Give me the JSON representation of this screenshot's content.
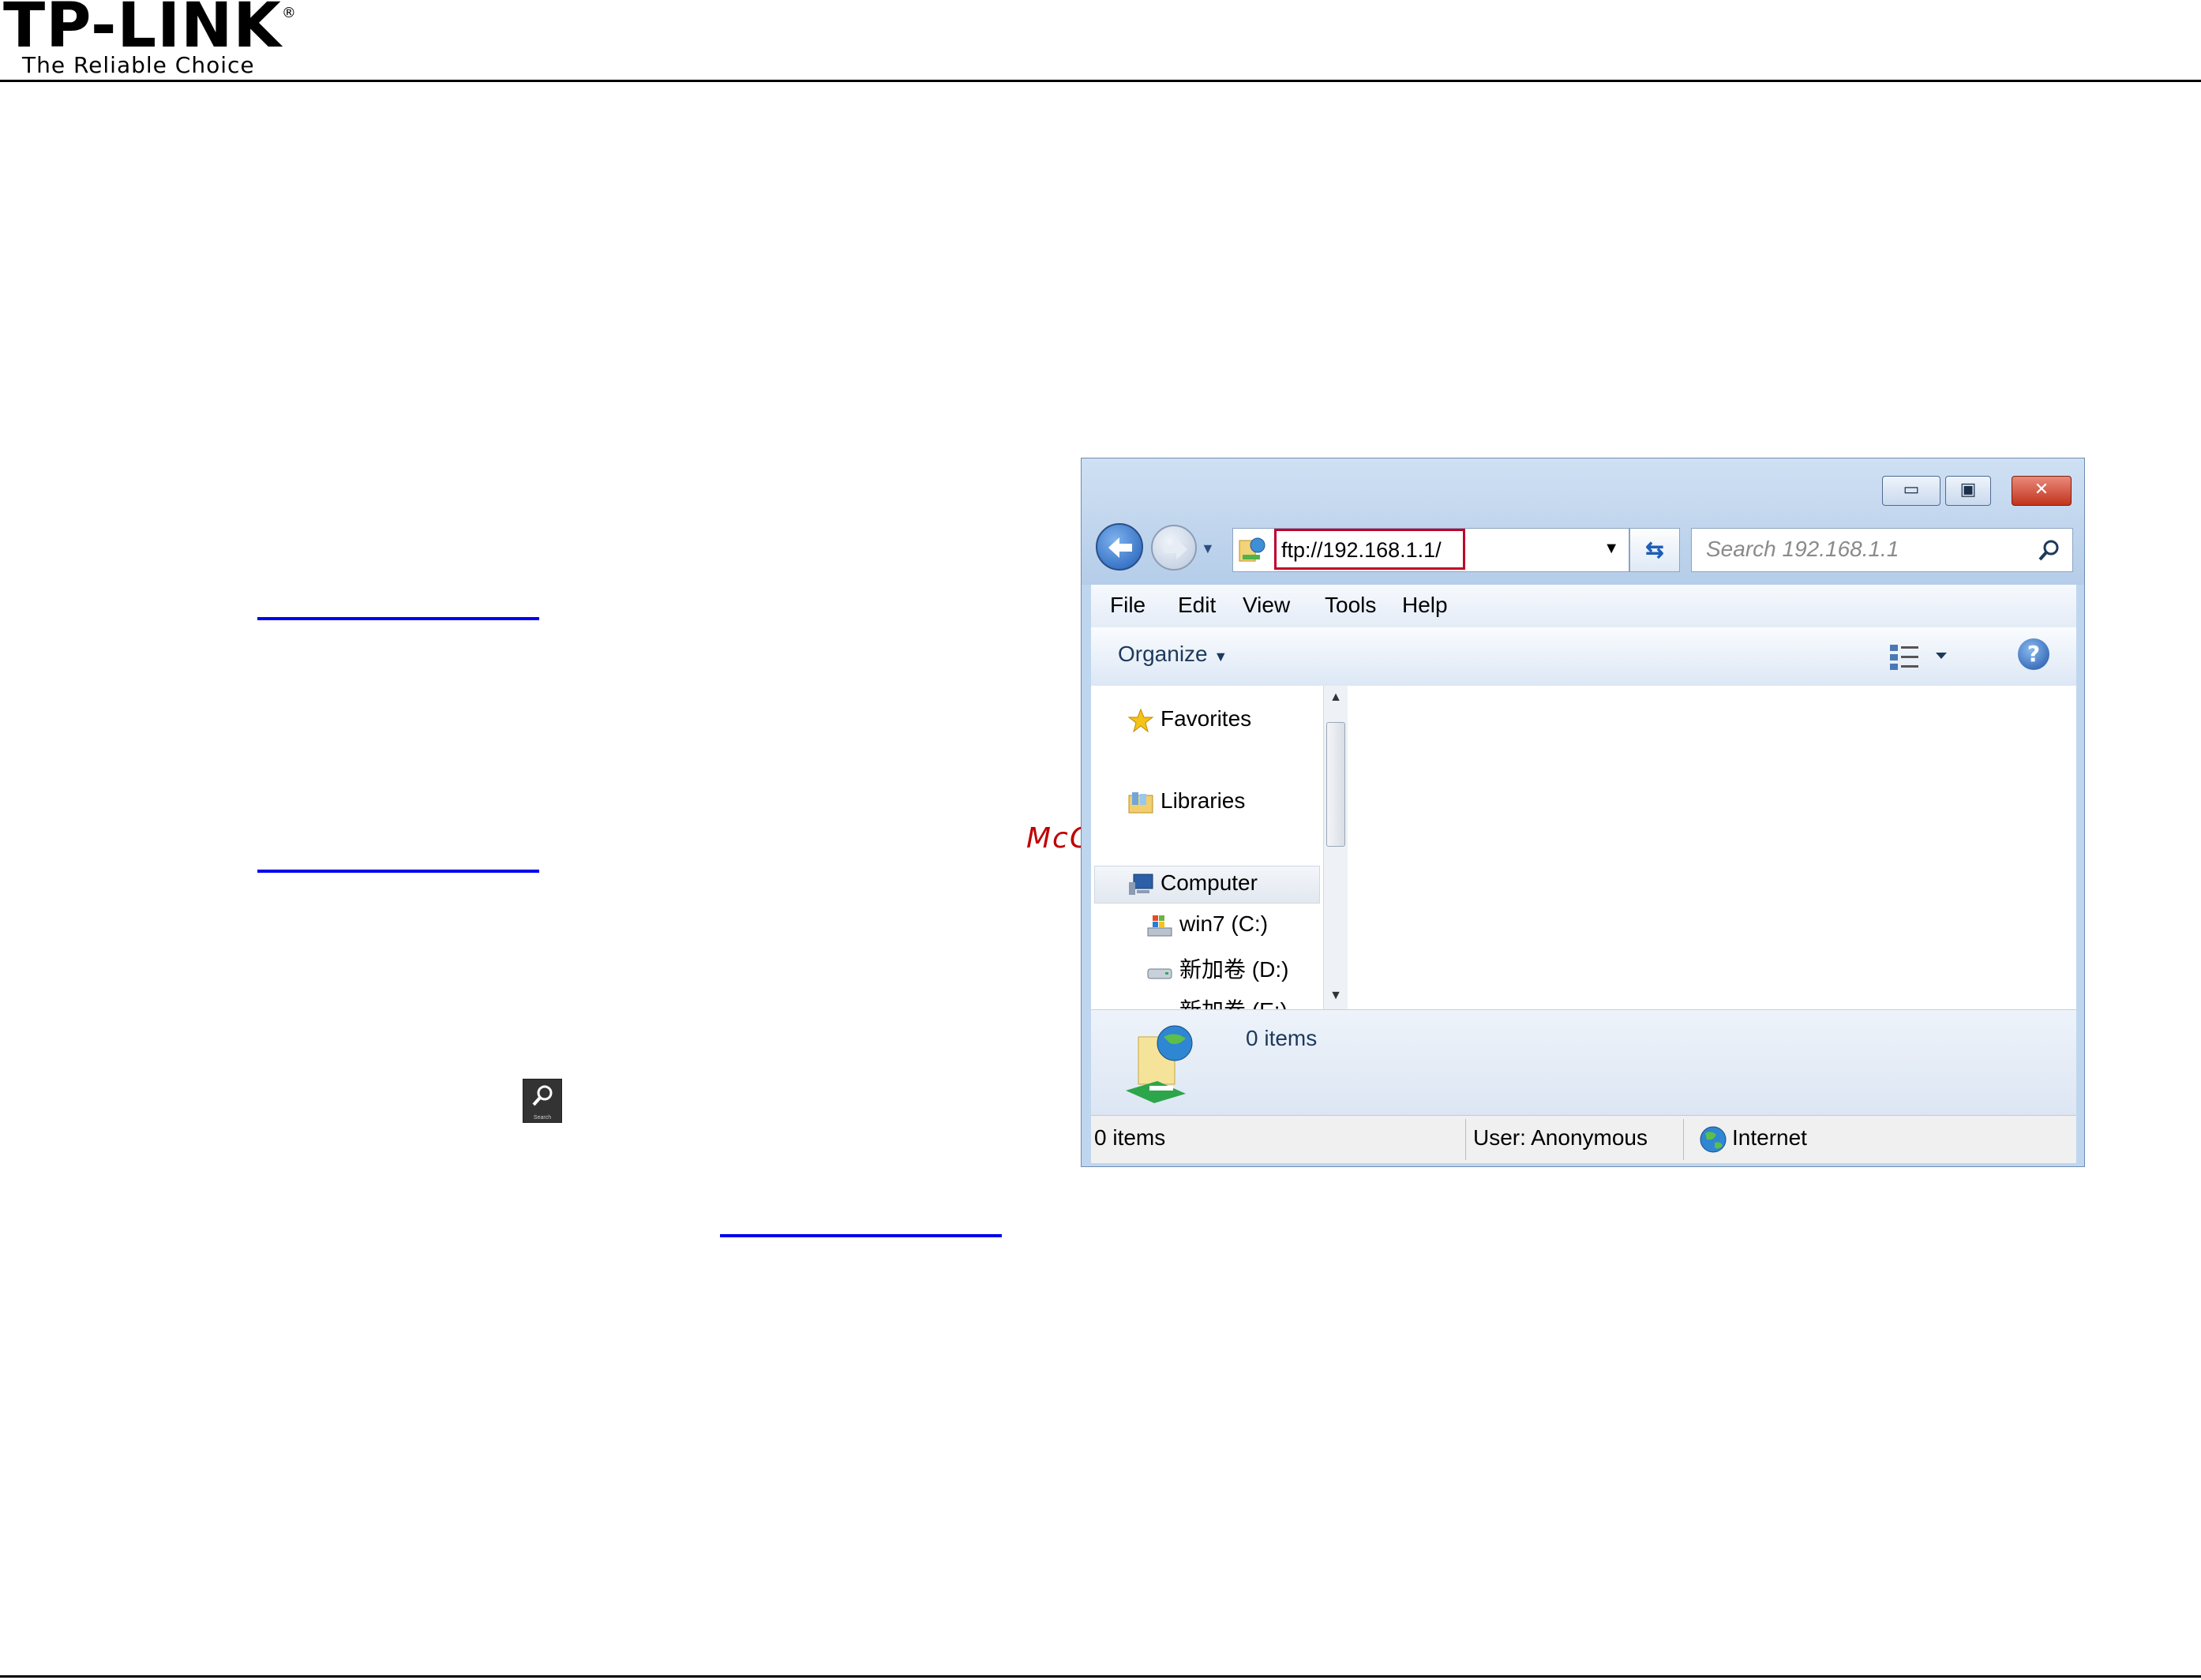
{
  "header": {
    "logo": "TP-LINK",
    "logo_mark": "®",
    "tagline": "The Reliable Choice"
  },
  "watermark": "McGrp.Ru",
  "search_tile": {
    "icon": "search-icon",
    "label": "Search"
  },
  "explorer": {
    "address": {
      "url": "ftp://192.168.1.1/"
    },
    "search": {
      "placeholder": "Search 192.168.1.1"
    },
    "menu": [
      "File",
      "Edit",
      "View",
      "Tools",
      "Help"
    ],
    "toolbar": {
      "organize_label": "Organize"
    },
    "nav": {
      "favorites": "Favorites",
      "libraries": "Libraries",
      "computer": "Computer",
      "drive_c": "win7 (C:)",
      "drive_d": "新加卷 (D:)",
      "drive_e": "新加卷 (E:)"
    },
    "details": {
      "count": "0 items"
    },
    "status": {
      "items": "0 items",
      "user": "User: Anonymous",
      "zone": "Internet"
    }
  }
}
